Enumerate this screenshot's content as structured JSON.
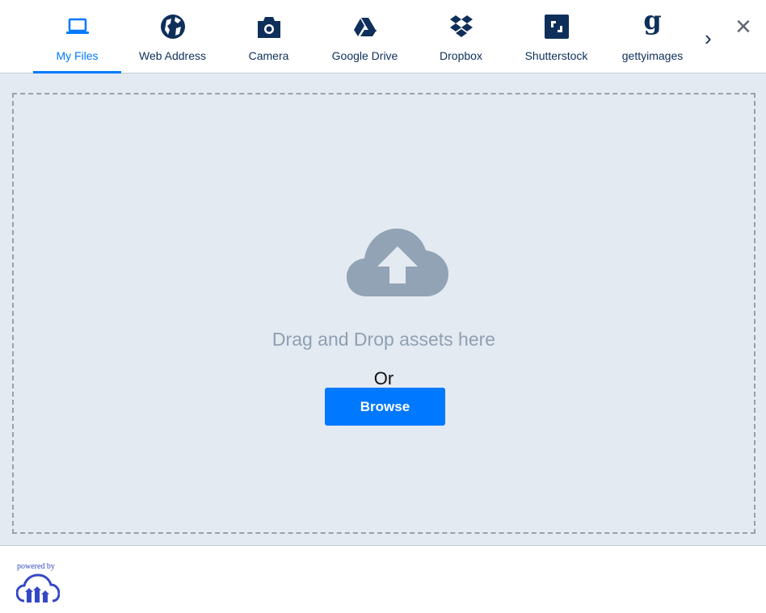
{
  "tabs": [
    {
      "label": "My Files",
      "icon": "laptop-icon"
    },
    {
      "label": "Web Address",
      "icon": "globe-icon"
    },
    {
      "label": "Camera",
      "icon": "camera-icon"
    },
    {
      "label": "Google Drive",
      "icon": "google-drive-icon"
    },
    {
      "label": "Dropbox",
      "icon": "dropbox-icon"
    },
    {
      "label": "Shutterstock",
      "icon": "shutterstock-icon"
    },
    {
      "label": "gettyimages",
      "icon": "gettyimages-icon"
    }
  ],
  "more_label": "›",
  "close_label": "×",
  "dropzone": {
    "text": "Drag and Drop assets here",
    "or": "Or",
    "browse": "Browse"
  },
  "footer": {
    "powered_by": "powered by"
  },
  "colors": {
    "accent": "#0078ff",
    "navy": "#0e2f5a",
    "dropzone_bg": "#e3eaf1",
    "muted": "#8fa0b3"
  }
}
